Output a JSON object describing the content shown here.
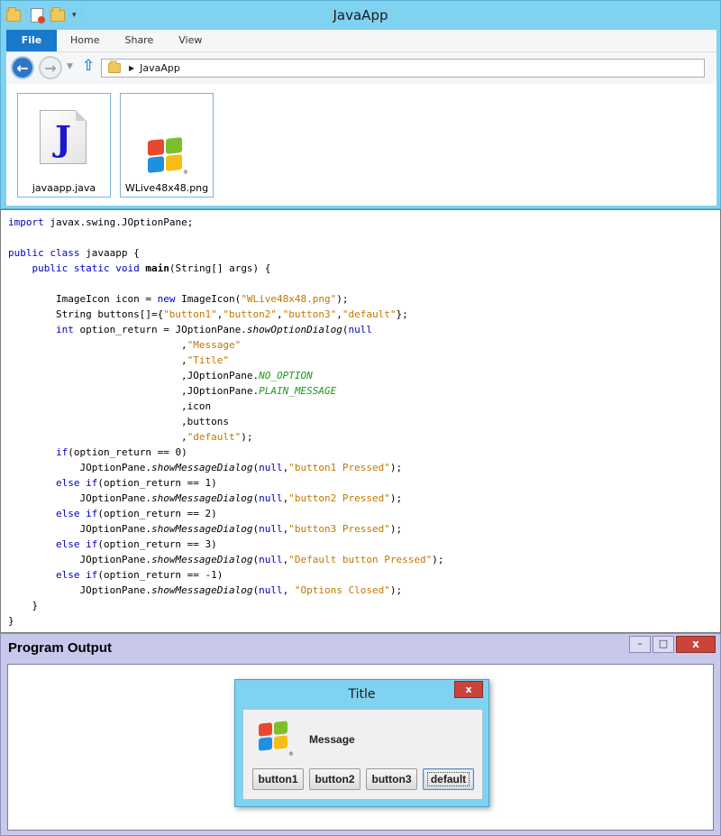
{
  "explorer": {
    "title": "JavaApp",
    "ribbon_tabs": [
      "File",
      "Home",
      "Share",
      "View"
    ],
    "address": "JavaApp",
    "files": [
      {
        "name": "javaapp.java",
        "icon": "java-file-icon"
      },
      {
        "name": "WLive48x48.png",
        "icon": "windows-logo-icon"
      }
    ]
  },
  "output": {
    "title": "Program Output",
    "controls": {
      "minimize": "–",
      "maximize": "□",
      "close": "x"
    }
  },
  "dialog": {
    "title": "Title",
    "close": "x",
    "message": "Message",
    "buttons": [
      "button1",
      "button2",
      "button3",
      "default"
    ]
  },
  "colors": {
    "window_frame": "#7fd2f0",
    "file_tab": "#1979ca",
    "keyword": "#0000c0",
    "string": "#c07800",
    "constant": "#1a9a1a",
    "output_frame": "#c8c8ec",
    "close_button": "#c9443a"
  }
}
